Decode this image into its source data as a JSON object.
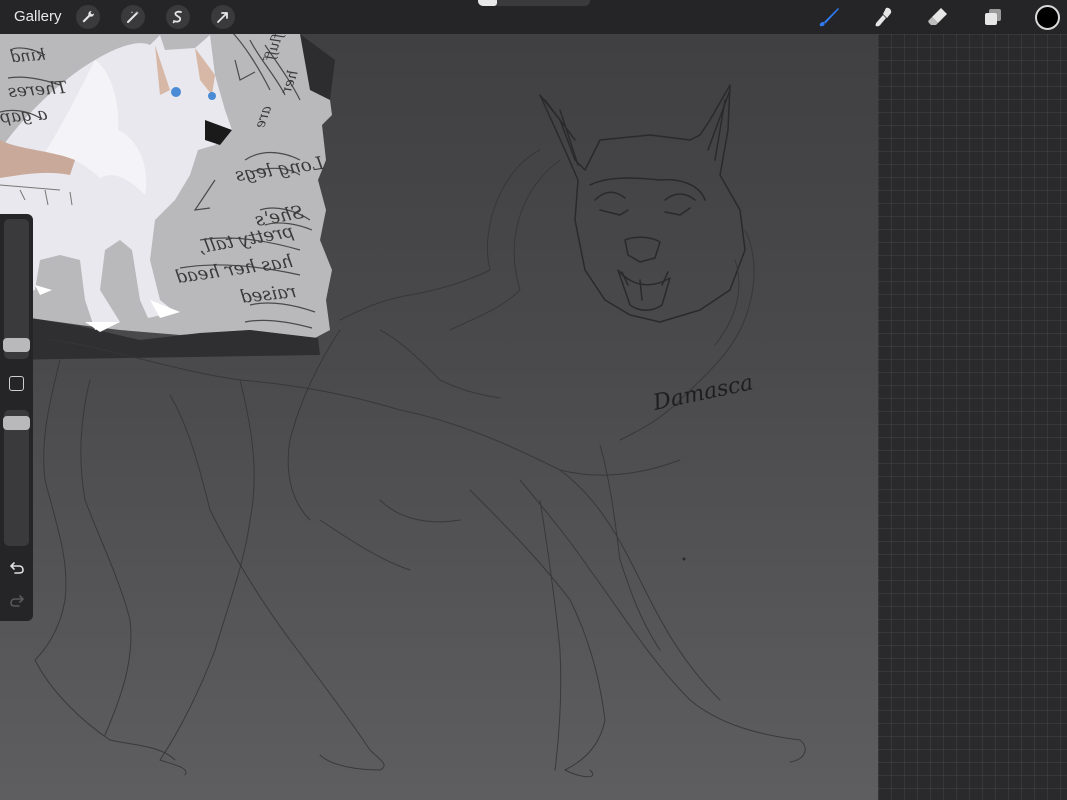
{
  "topbar": {
    "gallery_label": "Gallery",
    "left_tools": [
      "wrench-icon",
      "magic-wand-icon",
      "selection-icon",
      "transform-arrow-icon"
    ],
    "right_tools": [
      "brush-icon",
      "smudge-icon",
      "eraser-icon",
      "layers-icon"
    ],
    "active_tool": "brush-icon",
    "current_color": "#000000",
    "accent_color": "#2f7bf5"
  },
  "sidebar": {
    "brush_size": 0.24,
    "brush_opacity": 1.0,
    "icons": [
      "modify-square-icon",
      "undo-icon",
      "redo-icon"
    ]
  },
  "canvas": {
    "reference_notes": [
      "Long legs",
      "She's",
      "pretty tall,",
      "has her head",
      "raised",
      "Theres",
      "a gap",
      "kind",
      "are",
      "her",
      "fluff"
    ],
    "signature": "Damasca"
  }
}
